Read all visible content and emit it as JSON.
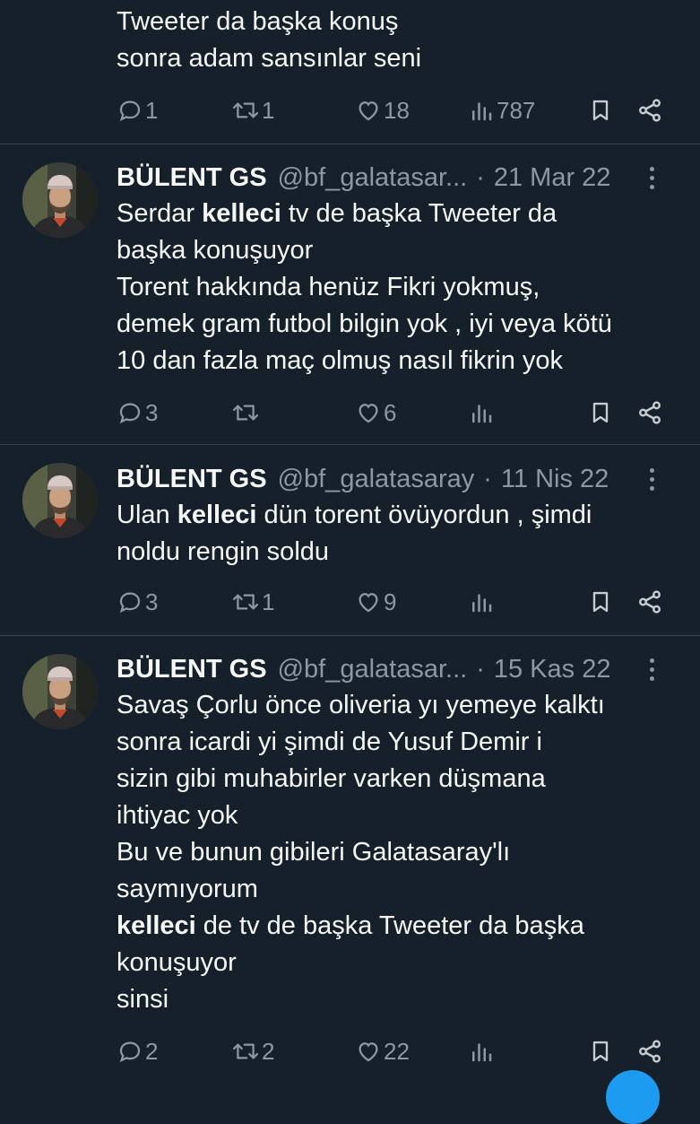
{
  "tweets": [
    {
      "lines": [
        {
          "segments": [
            {
              "text": "Tweeter da başka konuş",
              "bold": false
            }
          ]
        },
        {
          "segments": [
            {
              "text": "sonra adam sansınlar seni",
              "bold": false
            }
          ]
        }
      ],
      "stats": {
        "replies": "1",
        "retweets": "1",
        "likes": "18",
        "views": "787"
      }
    },
    {
      "name": "BÜLENT GS",
      "handle": "@bf_galatasar...",
      "separator": "·",
      "date": "21 Mar 22",
      "lines": [
        {
          "segments": [
            {
              "text": "Serdar ",
              "bold": false
            },
            {
              "text": "kelleci",
              "bold": true
            },
            {
              "text": " tv de başka Tweeter da",
              "bold": false
            }
          ]
        },
        {
          "segments": [
            {
              "text": "başka konuşuyor",
              "bold": false
            }
          ]
        },
        {
          "segments": [
            {
              "text": "Torent hakkında henüz Fikri yokmuş,",
              "bold": false
            }
          ]
        },
        {
          "segments": [
            {
              "text": "demek gram futbol bilgin yok , iyi veya kötü",
              "bold": false
            }
          ]
        },
        {
          "segments": [
            {
              "text": "10 dan fazla maç olmuş nasıl fikrin yok",
              "bold": false
            }
          ]
        }
      ],
      "stats": {
        "replies": "3",
        "retweets": "",
        "likes": "6",
        "views": ""
      }
    },
    {
      "name": "BÜLENT GS",
      "handle": "@bf_galatasaray",
      "separator": "·",
      "date": "11 Nis 22",
      "lines": [
        {
          "segments": [
            {
              "text": "Ulan ",
              "bold": false
            },
            {
              "text": "kelleci",
              "bold": true
            },
            {
              "text": " dün torent övüyordun , şimdi",
              "bold": false
            }
          ]
        },
        {
          "segments": [
            {
              "text": "noldu rengin soldu",
              "bold": false
            }
          ]
        }
      ],
      "stats": {
        "replies": "3",
        "retweets": "1",
        "likes": "9",
        "views": ""
      }
    },
    {
      "name": "BÜLENT GS",
      "handle": "@bf_galatasar...",
      "separator": "·",
      "date": "15 Kas 22",
      "lines": [
        {
          "segments": [
            {
              "text": "Savaş Çorlu önce oliveria yı yemeye kalktı",
              "bold": false
            }
          ]
        },
        {
          "segments": [
            {
              "text": "sonra icardi yi şimdi de Yusuf Demir i",
              "bold": false
            }
          ]
        },
        {
          "segments": [
            {
              "text": "sizin gibi muhabirler varken düşmana",
              "bold": false
            }
          ]
        },
        {
          "segments": [
            {
              "text": "ihtiyac yok",
              "bold": false
            }
          ]
        },
        {
          "segments": [
            {
              "text": "Bu ve bunun gibileri Galatasaray'lı",
              "bold": false
            }
          ]
        },
        {
          "segments": [
            {
              "text": "saymıyorum",
              "bold": false
            }
          ]
        },
        {
          "segments": [
            {
              "text": "kelleci",
              "bold": true
            },
            {
              "text": " de tv de başka Tweeter da başka",
              "bold": false
            }
          ]
        },
        {
          "segments": [
            {
              "text": "konuşuyor",
              "bold": false
            }
          ]
        },
        {
          "segments": [
            {
              "text": "sinsi",
              "bold": false
            }
          ]
        }
      ],
      "stats": {
        "replies": "2",
        "retweets": "2",
        "likes": "22",
        "views": ""
      }
    }
  ],
  "icons": {
    "reply": "reply-icon",
    "retweet": "retweet-icon",
    "like": "heart-icon",
    "views": "views-chart-icon",
    "bookmark": "bookmark-icon",
    "share": "share-icon",
    "more": "more-dots-icon",
    "avatar": "avatar"
  },
  "colors": {
    "background": "#15202b",
    "text": "#f7f9f9",
    "secondary": "#8b98a5",
    "divider": "#38444d",
    "accent": "#1d9bf0"
  }
}
